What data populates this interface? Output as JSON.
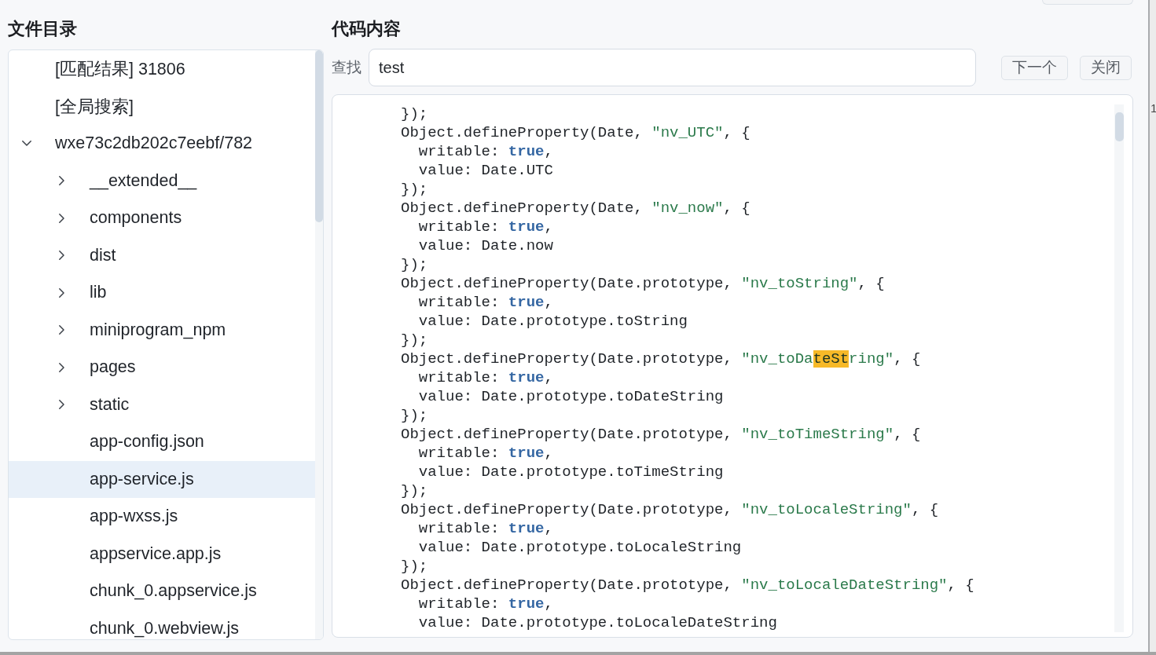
{
  "file_tree": {
    "title": "文件目录",
    "items": [
      {
        "kind": "entry",
        "label": "[匹配结果] 31806",
        "selected": false
      },
      {
        "kind": "entry",
        "label": "[全局搜索]",
        "selected": false
      },
      {
        "kind": "folder",
        "label": "wxe73c2db202c7eebf/782",
        "expanded": true,
        "selected": false,
        "children": [
          {
            "kind": "folder",
            "label": "__extended__",
            "expanded": false,
            "selected": false
          },
          {
            "kind": "folder",
            "label": "components",
            "expanded": false,
            "selected": false
          },
          {
            "kind": "folder",
            "label": "dist",
            "expanded": false,
            "selected": false
          },
          {
            "kind": "folder",
            "label": "lib",
            "expanded": false,
            "selected": false
          },
          {
            "kind": "folder",
            "label": "miniprogram_npm",
            "expanded": false,
            "selected": false
          },
          {
            "kind": "folder",
            "label": "pages",
            "expanded": false,
            "selected": false
          },
          {
            "kind": "folder",
            "label": "static",
            "expanded": false,
            "selected": false
          },
          {
            "kind": "file",
            "label": "app-config.json",
            "selected": false
          },
          {
            "kind": "file",
            "label": "app-service.js",
            "selected": true
          },
          {
            "kind": "file",
            "label": "app-wxss.js",
            "selected": false
          },
          {
            "kind": "file",
            "label": "appservice.app.js",
            "selected": false
          },
          {
            "kind": "file",
            "label": "chunk_0.appservice.js",
            "selected": false
          },
          {
            "kind": "file",
            "label": "chunk_0.webview.js",
            "selected": false
          }
        ]
      }
    ]
  },
  "code_view": {
    "title": "代码内容",
    "search": {
      "label": "查找",
      "value": "test"
    },
    "buttons": [
      {
        "label": "下一个"
      },
      {
        "label": "关闭"
      }
    ],
    "lines": [
      {
        "tokens": [
          {
            "kind": "plain",
            "text": "});"
          }
        ]
      },
      {
        "tokens": [
          {
            "kind": "plain",
            "text": "Object.defineProperty(Date, "
          },
          {
            "kind": "string",
            "text": "\"nv_UTC\""
          },
          {
            "kind": "plain",
            "text": ", {"
          }
        ]
      },
      {
        "tokens": [
          {
            "kind": "plain",
            "text": "  writable: "
          },
          {
            "kind": "keyword",
            "text": "true"
          },
          {
            "kind": "plain",
            "text": ","
          }
        ]
      },
      {
        "tokens": [
          {
            "kind": "plain",
            "text": "  value: Date.UTC"
          }
        ]
      },
      {
        "tokens": [
          {
            "kind": "plain",
            "text": "});"
          }
        ]
      },
      {
        "tokens": [
          {
            "kind": "plain",
            "text": "Object.defineProperty(Date, "
          },
          {
            "kind": "string",
            "text": "\"nv_now\""
          },
          {
            "kind": "plain",
            "text": ", {"
          }
        ]
      },
      {
        "tokens": [
          {
            "kind": "plain",
            "text": "  writable: "
          },
          {
            "kind": "keyword",
            "text": "true"
          },
          {
            "kind": "plain",
            "text": ","
          }
        ]
      },
      {
        "tokens": [
          {
            "kind": "plain",
            "text": "  value: Date.now"
          }
        ]
      },
      {
        "tokens": [
          {
            "kind": "plain",
            "text": "});"
          }
        ]
      },
      {
        "tokens": [
          {
            "kind": "plain",
            "text": "Object.defineProperty(Date.prototype, "
          },
          {
            "kind": "string",
            "text": "\"nv_toString\""
          },
          {
            "kind": "plain",
            "text": ", {"
          }
        ]
      },
      {
        "tokens": [
          {
            "kind": "plain",
            "text": "  writable: "
          },
          {
            "kind": "keyword",
            "text": "true"
          },
          {
            "kind": "plain",
            "text": ","
          }
        ]
      },
      {
        "tokens": [
          {
            "kind": "plain",
            "text": "  value: Date.prototype.toString"
          }
        ]
      },
      {
        "tokens": [
          {
            "kind": "plain",
            "text": "});"
          }
        ]
      },
      {
        "tokens": [
          {
            "kind": "plain",
            "text": "Object.defineProperty(Date.prototype, "
          },
          {
            "kind": "string",
            "text": "\"nv_toDa"
          },
          {
            "kind": "match",
            "text": "teSt"
          },
          {
            "kind": "string",
            "text": "ring\""
          },
          {
            "kind": "plain",
            "text": ", {"
          }
        ]
      },
      {
        "tokens": [
          {
            "kind": "plain",
            "text": "  writable: "
          },
          {
            "kind": "keyword",
            "text": "true"
          },
          {
            "kind": "plain",
            "text": ","
          }
        ]
      },
      {
        "tokens": [
          {
            "kind": "plain",
            "text": "  value: Date.prototype.toDateString"
          }
        ]
      },
      {
        "tokens": [
          {
            "kind": "plain",
            "text": "});"
          }
        ]
      },
      {
        "tokens": [
          {
            "kind": "plain",
            "text": "Object.defineProperty(Date.prototype, "
          },
          {
            "kind": "string",
            "text": "\"nv_toTimeString\""
          },
          {
            "kind": "plain",
            "text": ", {"
          }
        ]
      },
      {
        "tokens": [
          {
            "kind": "plain",
            "text": "  writable: "
          },
          {
            "kind": "keyword",
            "text": "true"
          },
          {
            "kind": "plain",
            "text": ","
          }
        ]
      },
      {
        "tokens": [
          {
            "kind": "plain",
            "text": "  value: Date.prototype.toTimeString"
          }
        ]
      },
      {
        "tokens": [
          {
            "kind": "plain",
            "text": "});"
          }
        ]
      },
      {
        "tokens": [
          {
            "kind": "plain",
            "text": "Object.defineProperty(Date.prototype, "
          },
          {
            "kind": "string",
            "text": "\"nv_toLocaleString\""
          },
          {
            "kind": "plain",
            "text": ", {"
          }
        ]
      },
      {
        "tokens": [
          {
            "kind": "plain",
            "text": "  writable: "
          },
          {
            "kind": "keyword",
            "text": "true"
          },
          {
            "kind": "plain",
            "text": ","
          }
        ]
      },
      {
        "tokens": [
          {
            "kind": "plain",
            "text": "  value: Date.prototype.toLocaleString"
          }
        ]
      },
      {
        "tokens": [
          {
            "kind": "plain",
            "text": "});"
          }
        ]
      },
      {
        "tokens": [
          {
            "kind": "plain",
            "text": "Object.defineProperty(Date.prototype, "
          },
          {
            "kind": "string",
            "text": "\"nv_toLocaleDateString\""
          },
          {
            "kind": "plain",
            "text": ", {"
          }
        ]
      },
      {
        "tokens": [
          {
            "kind": "plain",
            "text": "  writable: "
          },
          {
            "kind": "keyword",
            "text": "true"
          },
          {
            "kind": "plain",
            "text": ","
          }
        ]
      },
      {
        "tokens": [
          {
            "kind": "plain",
            "text": "  value: Date.prototype.toLocaleDateString"
          }
        ]
      }
    ]
  },
  "behind_window": {
    "text": "1"
  }
}
